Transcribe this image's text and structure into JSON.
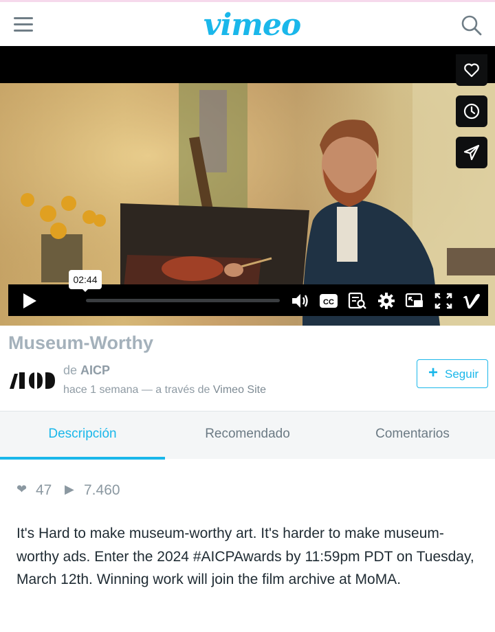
{
  "header": {
    "logo": "vimeo"
  },
  "player": {
    "tooltip_time": "02:44",
    "progress_fraction": 0.0
  },
  "video": {
    "title": "Museum-Worthy",
    "by_prefix": "de",
    "author": "AICP",
    "uploaded": "hace 1 semana — a través de",
    "source": "Vimeo Site",
    "follow_label": "Seguir"
  },
  "tabs": [
    {
      "label": "Descripción",
      "active": true
    },
    {
      "label": "Recomendado",
      "active": false
    },
    {
      "label": "Comentarios",
      "active": false
    }
  ],
  "stats": {
    "likes": "47",
    "plays": "7.460"
  },
  "description": "It's Hard to make museum-worthy art. It's harder to make museum-worthy ads. Enter the 2024 #AICPAwards by 11:59pm PDT on Tuesday, March 12th. Winning work will join the film archive at MoMA.",
  "colors": {
    "accent": "#1ab7ea",
    "title_gray": "#a4b1bb"
  }
}
